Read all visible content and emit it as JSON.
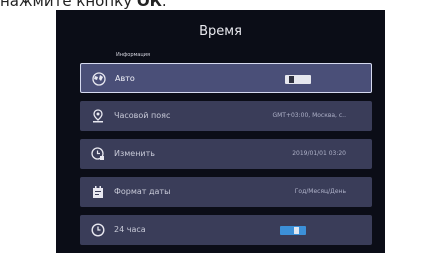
{
  "caption": {
    "prefix": "нажмите кнопку",
    "bold": "ОК"
  },
  "screen": {
    "title": "Время",
    "section_label": "Информация",
    "rows": [
      {
        "label": "Авто",
        "icon": "globe-icon",
        "toggle": "off"
      },
      {
        "label": "Часовой пояс",
        "icon": "location-pin-icon",
        "value": "GMT+03:00, Москва, с.."
      },
      {
        "label": "Изменить",
        "icon": "clock-edit-icon",
        "value": "2019/01/01 03:20"
      },
      {
        "label": "Формат даты",
        "icon": "calendar-icon",
        "value": "Год/Месяц/День"
      },
      {
        "label": "24 часа",
        "icon": "clock-icon",
        "toggle": "on"
      }
    ]
  },
  "colors": {
    "screen_bg": "#0b0d17",
    "row_bg": "#3a3d59",
    "selected_row_bg": "#4a4f78",
    "toggle_on": "#3c90d8"
  }
}
